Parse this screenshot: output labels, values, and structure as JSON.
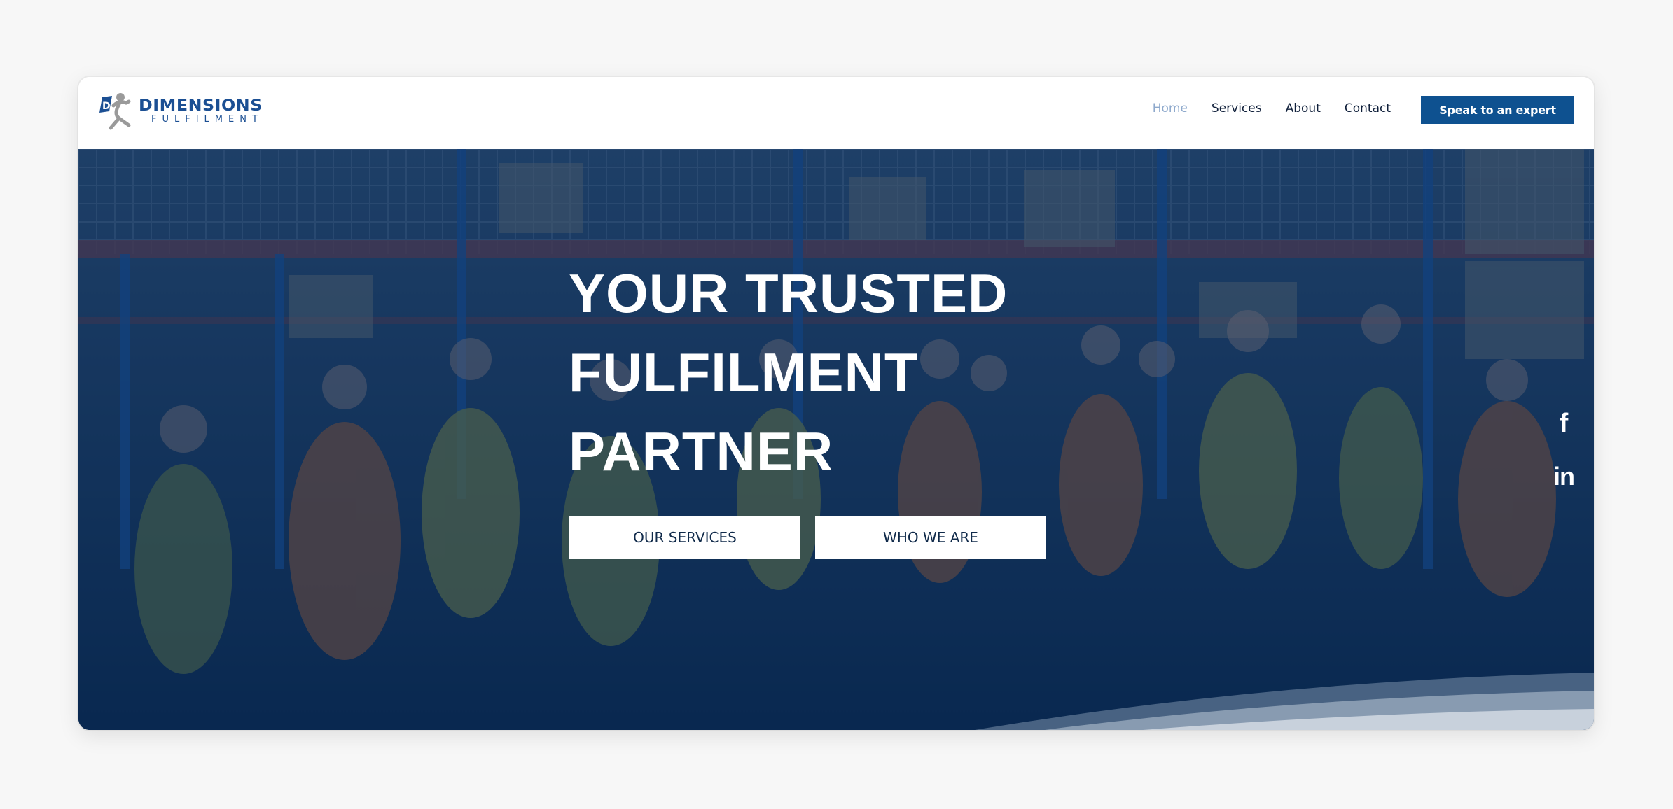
{
  "brand": {
    "name": "DIMENSIONS",
    "tagline": "FULFILMENT",
    "primary_color": "#0e5190",
    "logo_mark_letters": "DF"
  },
  "nav": {
    "items": [
      {
        "label": "Home",
        "active": true
      },
      {
        "label": "Services",
        "active": false
      },
      {
        "label": "About",
        "active": false
      },
      {
        "label": "Contact",
        "active": false
      }
    ],
    "cta_label": "Speak to an expert"
  },
  "hero": {
    "title_lines": [
      "YOUR TRUSTED",
      "FULFILMENT",
      "PARTNER"
    ],
    "buttons": [
      {
        "label": "OUR SERVICES"
      },
      {
        "label": "WHO WE ARE"
      }
    ],
    "background": "warehouse team photo with blue overlay",
    "overlay_color": "#08264e"
  },
  "social": {
    "facebook": {
      "icon": "facebook-icon",
      "glyph": "f"
    },
    "linkedin": {
      "icon": "linkedin-icon",
      "glyph": "in"
    }
  }
}
